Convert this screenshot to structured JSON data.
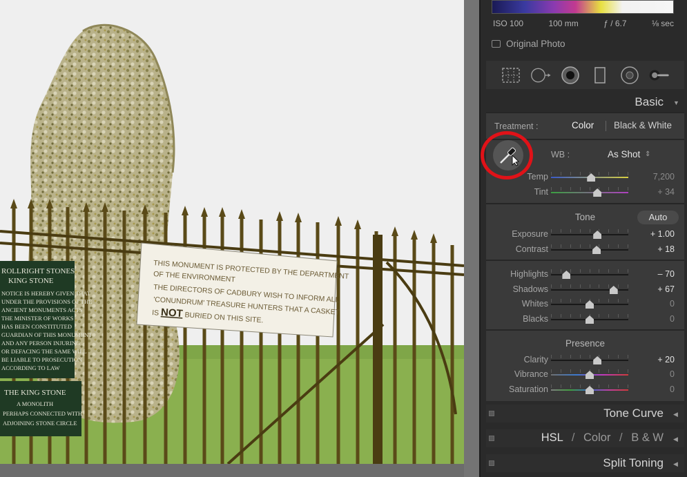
{
  "photo": {
    "sign_left": {
      "lines": [
        "ROLLRIGHT STONES",
        "KING STONE",
        "NOTICE IS HEREBY GIVEN THAT",
        "UNDER THE PROVISIONS OF THE",
        "ANCIENT MONUMENTS ACTS",
        "THE MINISTER OF WORKS",
        "HAS BEEN CONSTITUTED",
        "GUARDIAN OF THIS MONUMENT",
        "AND ANY PERSON INJURING",
        "OR DEFACING THE SAME WILL",
        "BE LIABLE TO PROSECUTION",
        "ACCORDING TO LAW"
      ],
      "lines2": [
        "THE KING STONE",
        "A MONOLITH",
        "PERHAPS CONNECTED WITH",
        "ADJOINING STONE CIRCLE"
      ]
    },
    "sign_white": {
      "line1": "THIS MONUMENT IS PROTECTED BY THE DEPARTMENT",
      "line2": "OF THE ENVIRONMENT",
      "line3": "THE DIRECTORS OF CADBURY WISH TO INFORM ALL",
      "line4": "'CONUNDRUM' TREASURE HUNTERS THAT A CASKET",
      "line5a": "IS ",
      "line5b": "NOT",
      "line5c": " BURIED ON THIS SITE."
    }
  },
  "exif": {
    "iso": "ISO 100",
    "focal": "100 mm",
    "aperture": "ƒ / 6.7",
    "shutter": "⅛ sec"
  },
  "original_photo_label": "Original Photo",
  "tools": [
    "crop-overlay-icon",
    "spot-removal-icon",
    "red-eye-icon",
    "graduated-filter-icon",
    "radial-filter-icon",
    "adjustment-brush-icon"
  ],
  "basic": {
    "title": "Basic",
    "treatment_label": "Treatment :",
    "treatment_color": "Color",
    "treatment_bw": "Black & White",
    "wb_label": "WB :",
    "wb_value": "As Shot",
    "wb_arrow": "⌃",
    "tone_label": "Tone",
    "auto_label": "Auto",
    "presence_label": "Presence",
    "sliders": [
      {
        "name": "temp",
        "label": "Temp",
        "value": "7,200",
        "pos": 0.52,
        "dim": true
      },
      {
        "name": "tint",
        "label": "Tint",
        "value": "+ 34",
        "pos": 0.6,
        "dim": true
      },
      {
        "name": "exposure",
        "label": "Exposure",
        "value": "+ 1.00",
        "pos": 0.6,
        "dim": false
      },
      {
        "name": "contrast",
        "label": "Contrast",
        "value": "+ 18",
        "pos": 0.59,
        "dim": false
      },
      {
        "name": "highlights",
        "label": "Highlights",
        "value": "– 70",
        "pos": 0.2,
        "dim": false
      },
      {
        "name": "shadows",
        "label": "Shadows",
        "value": "+ 67",
        "pos": 0.81,
        "dim": false
      },
      {
        "name": "whites",
        "label": "Whites",
        "value": "0",
        "pos": 0.5,
        "dim": true
      },
      {
        "name": "blacks",
        "label": "Blacks",
        "value": "0",
        "pos": 0.5,
        "dim": true
      },
      {
        "name": "clarity",
        "label": "Clarity",
        "value": "+ 20",
        "pos": 0.6,
        "dim": false
      },
      {
        "name": "vibrance",
        "label": "Vibrance",
        "value": "0",
        "pos": 0.5,
        "dim": true
      },
      {
        "name": "saturation",
        "label": "Saturation",
        "value": "0",
        "pos": 0.5,
        "dim": true
      }
    ]
  },
  "panels": {
    "tone_curve": "Tone Curve",
    "hsl": "HSL",
    "sep": "/",
    "color": "Color",
    "bw": "B & W",
    "split_toning": "Split Toning"
  },
  "colors": {
    "highlight_ring": "#e01218",
    "panel_bg": "#3a3a3a"
  }
}
